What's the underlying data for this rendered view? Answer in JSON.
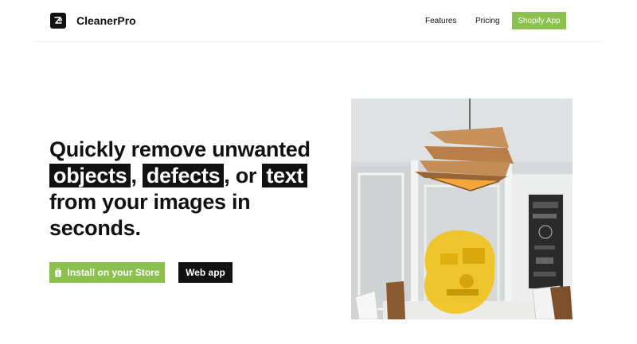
{
  "header": {
    "brand": "CleanerPro",
    "nav": {
      "features": "Features",
      "pricing": "Pricing",
      "shopify": "Shopify App"
    }
  },
  "hero": {
    "line1": "Quickly remove unwanted",
    "word_objects": "objects",
    "comma1": ",",
    "word_defects": "defects",
    "comma_or": ", or",
    "word_text": "text",
    "line3": "from your images in",
    "line4": "seconds."
  },
  "buttons": {
    "install": "Install on your Store",
    "webapp": "Web app"
  },
  "colors": {
    "accent_green": "#8bbf4f",
    "dark": "#111111",
    "highlight_mask": "#f2c21b"
  },
  "icons": {
    "logo": "cleanerpro-logo-icon",
    "install": "shopping-bag-icon"
  }
}
